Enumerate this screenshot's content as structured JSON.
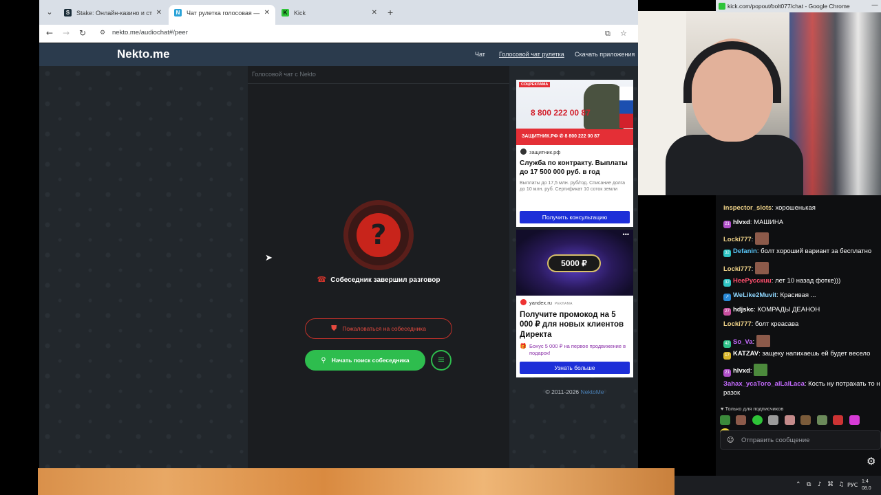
{
  "browser": {
    "tabs": [
      {
        "label": "Stake: Онлайн-казино и ставк",
        "favicon": "S"
      },
      {
        "label": "Чат рулетка голосовая — Nek",
        "favicon": "N"
      },
      {
        "label": "Kick",
        "favicon": "K"
      }
    ],
    "url": "nekto.me/audiochat#/peer"
  },
  "site": {
    "logo": "Nekto.me",
    "nav": [
      "Чат",
      "Голосовой чат рулетка",
      "Скачать приложения"
    ]
  },
  "chat_panel": {
    "title": "Голосовой чат с Nekto",
    "status": "Собеседник завершил разговор",
    "report_label": "Пожаловаться на собеседника",
    "search_label": "Начать поиск собеседника"
  },
  "ads": {
    "ad1": {
      "badge": "СОЦРЕКЛАМА",
      "phone": "8 800 222 00 87",
      "banner": "ЗАЩИТНИК.РФ  ✆ 8 800 222 00 87",
      "source": "защитник.рф",
      "headline": "Служба по контракту. Выплаты до 17 500 000 руб. в год",
      "text": "Выплаты до 17,5 млн. руб/год. Списание долга до 10 млн. руб. Сертификат 10 соток земли",
      "button": "Получить консультацию"
    },
    "ad2": {
      "promo": "5000 ₽",
      "source": "yandex.ru",
      "label": "РЕКЛАМА",
      "headline": "Получите промокод на 5 000 ₽ для новых клиентов Директа",
      "text": "Бонус 5 000 ₽ на первое продвижение в подарок!",
      "button": "Узнать больше"
    }
  },
  "footer": {
    "copyright": "© 2011-2026",
    "link": "NektoMe"
  },
  "kick": {
    "window_title": "kick.com/popout/bolt077/chat - Google Chrome",
    "messages": [
      {
        "user": "inspector_slots",
        "text": "хорошенькая",
        "color": "#f2d58a",
        "badge": ""
      },
      {
        "user": "hlvxd",
        "text": "МАШИНА",
        "color": "#ffffff",
        "badge": "21"
      },
      {
        "user": "Locki777",
        "text": "",
        "color": "#f2d58a",
        "badge": "",
        "emote": true
      },
      {
        "user": "Defanin",
        "text": "болт хороший вариант за бесплатно",
        "color": "#5ac8fa",
        "badge": "32"
      },
      {
        "user": "Locki777",
        "text": "",
        "color": "#f2d58a",
        "badge": "",
        "emote": true
      },
      {
        "user": "HeeРусскuu",
        "text": "лет 10 назад фотке)))",
        "color": "#ff4f6d",
        "badge": "32"
      },
      {
        "user": "WeLike2Muvit",
        "text": "Красивая ...",
        "color": "#8fd7ff",
        "badge": "↗"
      },
      {
        "user": "hdjskc",
        "text": "КОМРАДЫ ДЕАНОН",
        "color": "#ffffff",
        "badge": "27"
      },
      {
        "user": "Locki777",
        "text": "болт креасава",
        "color": "#f2d58a",
        "badge": ""
      },
      {
        "user": "So_Va",
        "text": "",
        "color": "#c56bff",
        "badge": "42",
        "emote": true
      },
      {
        "user": "KATZAV",
        "text": "защеку напихаешь ей будет весело",
        "color": "#ffffff",
        "badge": "17"
      },
      {
        "user": "hlvxd",
        "text": "",
        "color": "#ffffff",
        "badge": "21",
        "emote": true
      },
      {
        "user": "Заhах_ycaToго_alLalLaca",
        "text": "Кость ну потрахать то н",
        "color": "#c56bff",
        "badge": ""
      },
      {
        "user": "",
        "text": "разок",
        "color": "#ffffff",
        "badge": ""
      }
    ],
    "subs_only": "Только для подписчиков",
    "input_placeholder": "Отправить сообщение"
  },
  "taskbar": {
    "lang": "РУС",
    "time": "1:4",
    "date": "08.0"
  }
}
